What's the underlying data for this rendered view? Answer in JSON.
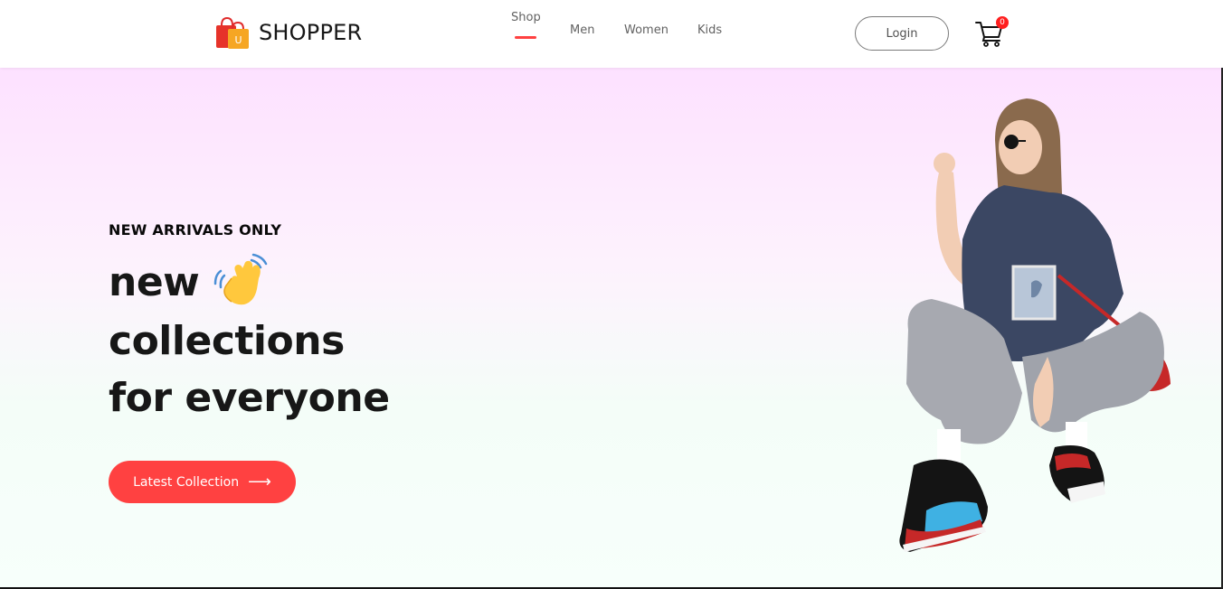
{
  "brand": {
    "name": "SHOPPER",
    "logo_letter": "U",
    "accent": "#ff4141"
  },
  "nav": {
    "items": [
      {
        "label": "Shop",
        "active": true
      },
      {
        "label": "Men",
        "active": false
      },
      {
        "label": "Women",
        "active": false
      },
      {
        "label": "Kids",
        "active": false
      }
    ]
  },
  "header": {
    "login_label": "Login",
    "cart_count": "0",
    "cart_icon": "cart-icon"
  },
  "hero": {
    "tag": "NEW ARRIVALS ONLY",
    "lines": [
      "new",
      "collections",
      "for everyone"
    ],
    "hand_icon": "waving-hand-icon",
    "cta_label": "Latest Collection",
    "cta_icon": "arrow-right-icon",
    "image": "woman-crouching-in-sneakers"
  }
}
